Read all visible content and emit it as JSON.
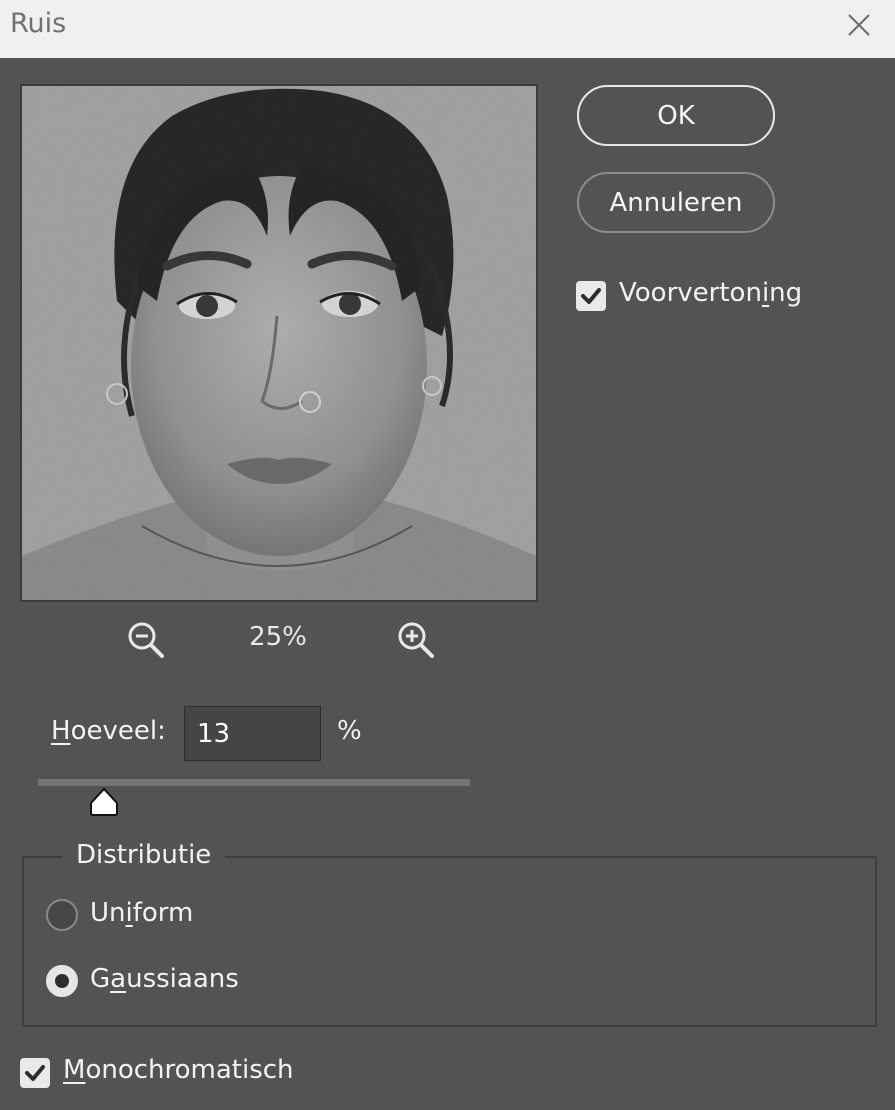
{
  "window": {
    "title": "Ruis",
    "close_icon": "close-icon"
  },
  "preview": {
    "zoom_level": "25%",
    "zoom_out_icon": "zoom-out-icon",
    "zoom_in_icon": "zoom-in-icon"
  },
  "buttons": {
    "ok": "OK",
    "cancel": "Annuleren"
  },
  "preview_checkbox": {
    "prefix": "Voorverton",
    "mnemonic": "i",
    "suffix": "ng",
    "checked": true
  },
  "amount": {
    "mnemonic": "H",
    "rest": "oeveel:",
    "value": "13",
    "unit": "%",
    "slider_fraction": 0.13
  },
  "distribution": {
    "legend": "Distributie",
    "options": [
      {
        "prefix": "Un",
        "mnemonic": "i",
        "suffix": "form",
        "selected": false
      },
      {
        "prefix": "G",
        "mnemonic": "a",
        "suffix": "ussiaans",
        "selected": true
      }
    ]
  },
  "monochrome": {
    "mnemonic": "M",
    "rest": "onochromatisch",
    "checked": true
  },
  "colors": {
    "dialog_bg": "#535353",
    "titlebar_bg": "#f0f0f0",
    "input_bg": "#454545"
  }
}
